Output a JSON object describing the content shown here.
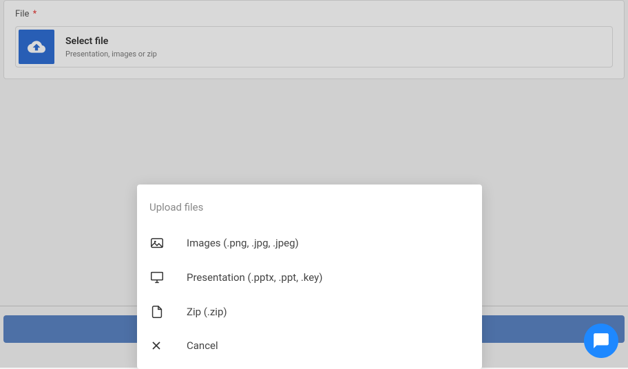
{
  "form": {
    "field_label": "File",
    "required_mark": "*",
    "select_title": "Select file",
    "select_sub": "Presentation, images or zip"
  },
  "popup": {
    "title": "Upload files",
    "items": [
      {
        "label": "Images (.png, .jpg, .jpeg)"
      },
      {
        "label": "Presentation (.pptx, .ppt, .key)"
      },
      {
        "label": "Zip (.zip)"
      },
      {
        "label": "Cancel"
      }
    ]
  }
}
